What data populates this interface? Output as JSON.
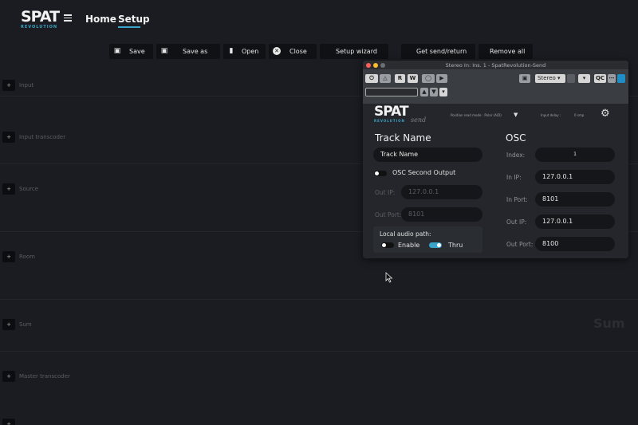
{
  "app": {
    "logo_text": "SPAT",
    "logo_sub": "REVOLUTION",
    "nav": {
      "home": "Home",
      "setup": "Setup"
    }
  },
  "toolbar": [
    {
      "label": "Save",
      "icon": "floppy-icon"
    },
    {
      "label": "Save as",
      "icon": "floppy-icon"
    },
    {
      "label": "Open",
      "icon": "folder-icon"
    },
    {
      "label": "Close",
      "icon": "close-icon"
    },
    {
      "label": "Setup wizard"
    },
    {
      "label": "Get send/return"
    },
    {
      "label": "Remove all"
    }
  ],
  "sections": [
    "Input",
    "Input transcoder",
    "Source",
    "Room",
    "Sum",
    "Master transcoder"
  ],
  "background_watermark": "Sum",
  "plugin": {
    "title": "Stereo In: Ins. 1 - SpatRevolution-Send",
    "host": {
      "r": "R",
      "w": "W",
      "format": "Stereo",
      "qc": "QC"
    },
    "logo_text": "SPAT",
    "logo_sub": "REVOLUTION",
    "logo_send": "send",
    "position_mode": "Position read mode : Polar (A/D)",
    "input_delay_label": "Input delay :",
    "input_delay_value": "0 smp",
    "track": {
      "heading": "Track Name",
      "name_value": "Track Name",
      "osc_second": "OSC Second Output",
      "out_ip_label": "Out IP:",
      "out_ip_value": "127.0.0.1",
      "out_port_label": "Out Port:",
      "out_port_value": "8101",
      "local_audio": "Local audio path:",
      "enable": "Enable",
      "thru": "Thru"
    },
    "osc": {
      "heading": "OSC",
      "index_label": "Index:",
      "index_value": "1",
      "in_ip_label": "In IP:",
      "in_ip_value": "127.0.0.1",
      "in_port_label": "In Port:",
      "in_port_value": "8101",
      "out_ip_label": "Out IP:",
      "out_ip_value": "127.0.0.1",
      "out_port_label": "Out Port:",
      "out_port_value": "8100"
    }
  },
  "colors": {
    "accent": "#3aa5c8",
    "background": "#1a1c21",
    "panel": "#24262b"
  }
}
